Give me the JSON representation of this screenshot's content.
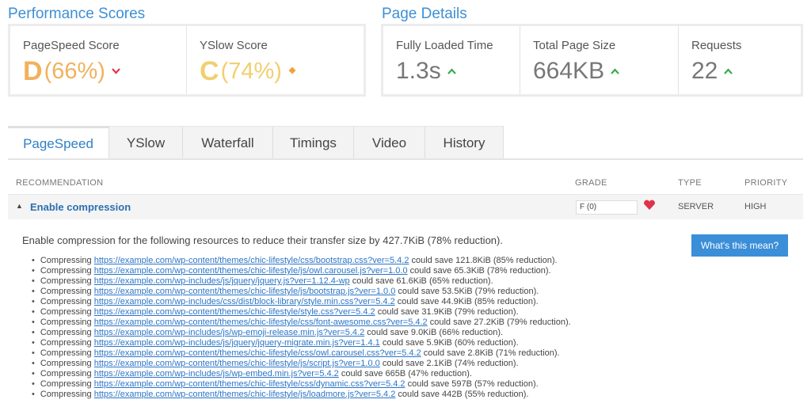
{
  "performance": {
    "title": "Performance Scores",
    "pagespeed": {
      "label": "PageSpeed Score",
      "grade": "D",
      "percent": "(66%)",
      "trend": "down"
    },
    "yslow": {
      "label": "YSlow Score",
      "grade": "C",
      "percent": "(74%)",
      "trend": "neutral"
    }
  },
  "details": {
    "title": "Page Details",
    "load_time": {
      "label": "Fully Loaded Time",
      "value": "1.3s",
      "trend": "up"
    },
    "page_size": {
      "label": "Total Page Size",
      "value": "664KB",
      "trend": "up"
    },
    "requests": {
      "label": "Requests",
      "value": "22",
      "trend": "up"
    }
  },
  "tabs": [
    {
      "label": "PageSpeed",
      "active": true
    },
    {
      "label": "YSlow"
    },
    {
      "label": "Waterfall"
    },
    {
      "label": "Timings"
    },
    {
      "label": "Video"
    },
    {
      "label": "History"
    }
  ],
  "table": {
    "headers": {
      "recommendation": "RECOMMENDATION",
      "grade": "GRADE",
      "type": "TYPE",
      "priority": "PRIORITY"
    }
  },
  "recommendation": {
    "name": "Enable compression",
    "grade": "F (0)",
    "type": "SERVER",
    "priority": "HIGH",
    "description": "Enable compression for the following resources to reduce their transfer size by 427.7KiB (78% reduction).",
    "help_label": "What's this mean?",
    "prefix": "Compressing",
    "resources": [
      {
        "url": "https://example.com/wp-content/themes/chic-lifestyle/css/bootstrap.css?ver=5.4.2",
        "saving": "could save 121.8KiB (85% reduction)."
      },
      {
        "url": "https://example.com/wp-content/themes/chic-lifestyle/js/owl.carousel.js?ver=1.0.0",
        "saving": "could save 65.3KiB (78% reduction)."
      },
      {
        "url": "https://example.com/wp-includes/js/jquery/jquery.js?ver=1.12.4-wp",
        "saving": "could save 61.6KiB (65% reduction)."
      },
      {
        "url": "https://example.com/wp-content/themes/chic-lifestyle/js/bootstrap.js?ver=1.0.0",
        "saving": "could save 53.5KiB (79% reduction)."
      },
      {
        "url": "https://example.com/wp-includes/css/dist/block-library/style.min.css?ver=5.4.2",
        "saving": "could save 44.9KiB (85% reduction)."
      },
      {
        "url": "https://example.com/wp-content/themes/chic-lifestyle/style.css?ver=5.4.2",
        "saving": "could save 31.9KiB (79% reduction)."
      },
      {
        "url": "https://example.com/wp-content/themes/chic-lifestyle/css/font-awesome.css?ver=5.4.2",
        "saving": "could save 27.2KiB (79% reduction)."
      },
      {
        "url": "https://example.com/wp-includes/js/wp-emoji-release.min.js?ver=5.4.2",
        "saving": "could save 9.0KiB (66% reduction)."
      },
      {
        "url": "https://example.com/wp-includes/js/jquery/jquery-migrate.min.js?ver=1.4.1",
        "saving": "could save 5.9KiB (60% reduction)."
      },
      {
        "url": "https://example.com/wp-content/themes/chic-lifestyle/css/owl.carousel.css?ver=5.4.2",
        "saving": "could save 2.8KiB (71% reduction)."
      },
      {
        "url": "https://example.com/wp-content/themes/chic-lifestyle/js/script.js?ver=1.0.0",
        "saving": "could save 2.1KiB (74% reduction)."
      },
      {
        "url": "https://example.com/wp-includes/js/wp-embed.min.js?ver=5.4.2",
        "saving": "could save 665B (47% reduction)."
      },
      {
        "url": "https://example.com/wp-content/themes/chic-lifestyle/css/dynamic.css?ver=5.4.2",
        "saving": "could save 597B (57% reduction)."
      },
      {
        "url": "https://example.com/wp-content/themes/chic-lifestyle/js/loadmore.js?ver=5.4.2",
        "saving": "could save 442B (55% reduction)."
      }
    ]
  },
  "colors": {
    "accent": "#3d8fd4",
    "grade_d": "#f1b25c",
    "grade_c": "#f0cf6e",
    "trend_up": "#3aa94f",
    "trend_down": "#e0334a",
    "trend_neutral": "#f0a23a"
  },
  "icons": {
    "trend_up": "chevron-up-icon",
    "trend_down": "chevron-down-icon",
    "trend_neutral": "diamond-icon",
    "expand": "triangle-up-icon",
    "grade": "heart-icon"
  }
}
